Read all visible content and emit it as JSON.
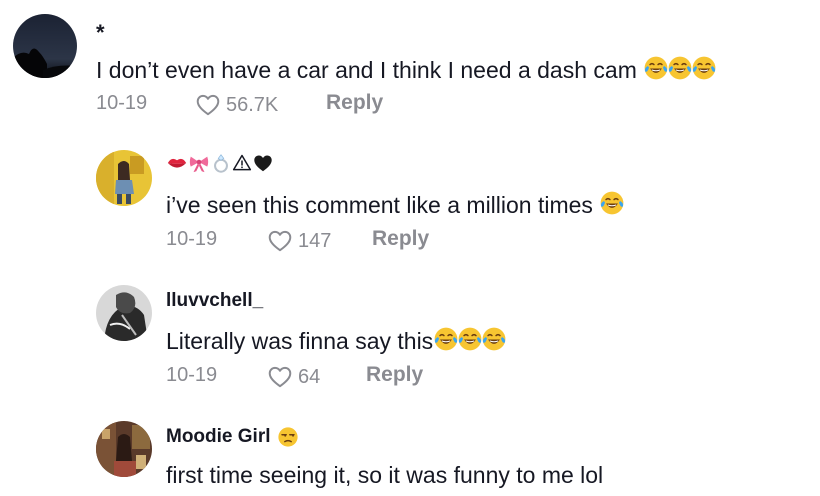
{
  "comments": [
    {
      "username": "*",
      "text": "I don’t even have a car and I think I need a dash cam",
      "text_emoji": [
        "face-with-tears-of-joy-icon",
        "face-with-tears-of-joy-icon",
        "face-with-tears-of-joy-icon"
      ],
      "date": "10-19",
      "likes": "56.7K",
      "reply_label": "Reply"
    },
    {
      "username_emoji": [
        "kiss-mark-icon",
        "ribbon-icon",
        "ring-icon",
        "warning-sign-icon",
        "black-heart-icon"
      ],
      "text": "i’ve seen this comment like a million times",
      "text_emoji": [
        "face-with-tears-of-joy-icon"
      ],
      "date": "10-19",
      "likes": "147",
      "reply_label": "Reply"
    },
    {
      "username": "lluvvchell_",
      "text": "Literally was finna say this",
      "text_emoji": [
        "face-with-tears-of-joy-icon",
        "face-with-tears-of-joy-icon",
        "face-with-tears-of-joy-icon"
      ],
      "date": "10-19",
      "likes": "64",
      "reply_label": "Reply"
    },
    {
      "username": "Moodie Girl",
      "username_emoji": [
        "unamused-face-icon"
      ],
      "text": "first time seeing it, so it was funny to me lol"
    }
  ],
  "colors": {
    "text": "#161823",
    "muted": "#8a8b91",
    "background": "#ffffff"
  }
}
